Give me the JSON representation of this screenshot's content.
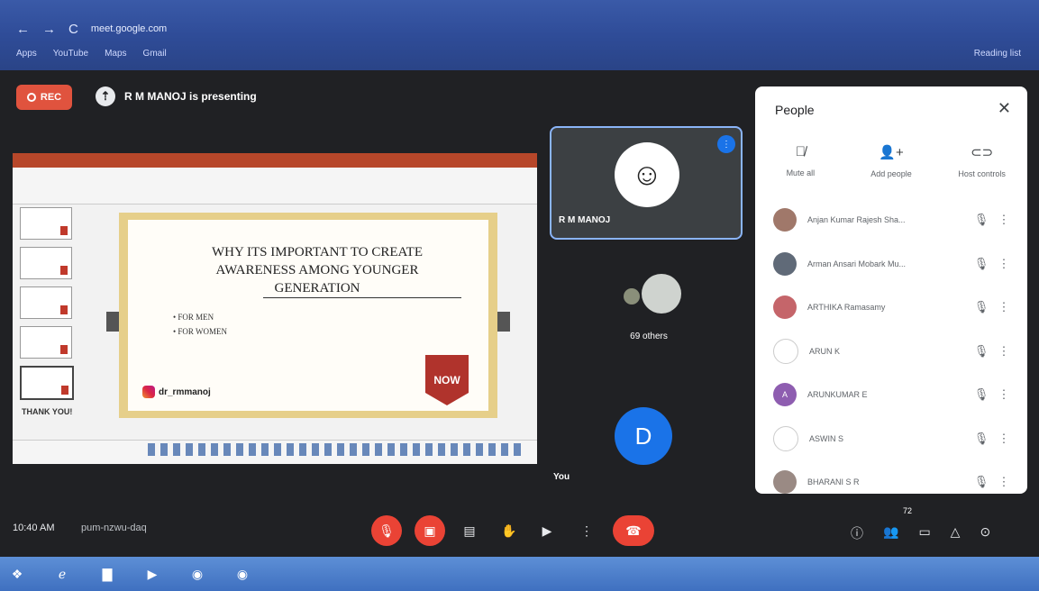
{
  "browser": {
    "url": "meet.google.com",
    "bookmarks": [
      "Apps",
      "YouTube",
      "Maps",
      "Gmail"
    ],
    "reading_list": "Reading list"
  },
  "meet": {
    "rec_label": "REC",
    "presenting_label": "R M MANOJ is presenting",
    "presenter_name": "R M MANOJ",
    "others_label": "69 others",
    "self_initial": "D",
    "self_label": "You",
    "time": "10:40 AM",
    "meeting_code": "pum-nzwu-daq",
    "participant_count": "72"
  },
  "slide": {
    "title_lines": [
      "WHY ITS IMPORTANT TO CREATE",
      "AWARENESS AMONG YOUNGER",
      "GENERATION"
    ],
    "bullets": [
      "FOR MEN",
      "FOR WOMEN"
    ],
    "instagram": "dr_rmmanoj",
    "badge": "NOW",
    "thumb_text": "THANK YOU!"
  },
  "people": {
    "title": "People",
    "actions": [
      {
        "label": "Mute all",
        "icon": "mic-off-icon"
      },
      {
        "label": "Add people",
        "icon": "add-person-icon"
      },
      {
        "label": "Host controls",
        "icon": "host-controls-icon"
      }
    ],
    "list": [
      {
        "name": "Anjan Kumar Rajesh Sha...",
        "color": "#a0786a",
        "initial": ""
      },
      {
        "name": "Arman Ansari Mobark Mu...",
        "color": "#606a78",
        "initial": ""
      },
      {
        "name": "ARTHIKA Ramasamy",
        "color": "#c5656a",
        "initial": ""
      },
      {
        "name": "ARUN K",
        "color": "#ffffff",
        "initial": ""
      },
      {
        "name": "ARUNKUMAR E",
        "color": "#8e5db0",
        "initial": "A"
      },
      {
        "name": "ASWIN S",
        "color": "#ffffff",
        "initial": ""
      },
      {
        "name": "BHARANI S R",
        "color": "#9a8a84",
        "initial": ""
      }
    ]
  }
}
